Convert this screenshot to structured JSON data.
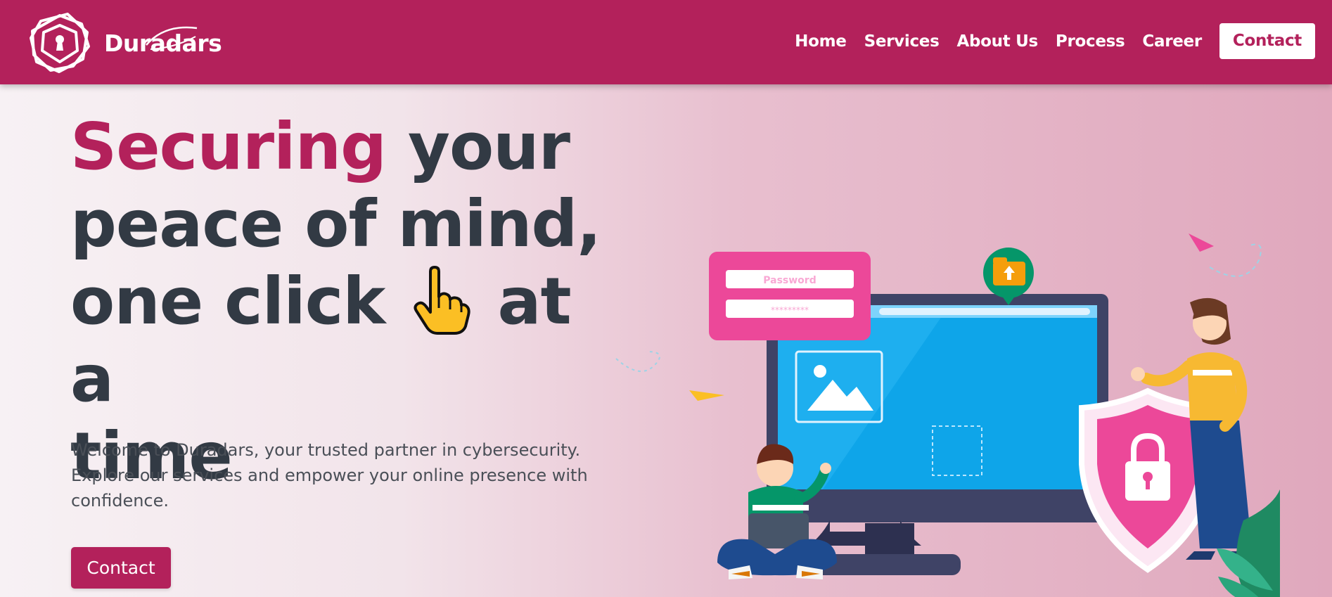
{
  "brand": {
    "name": "Duradars",
    "logo_icon": "shield-keyhole-icon"
  },
  "nav": {
    "items": [
      {
        "label": "Home"
      },
      {
        "label": "Services"
      },
      {
        "label": "About Us"
      },
      {
        "label": "Process"
      },
      {
        "label": "Career"
      }
    ],
    "contact_label": "Contact"
  },
  "hero": {
    "title_accent": "Securing",
    "title_line1_rest": " your",
    "title_line2": "peace of mind,",
    "title_line3_start": "one click",
    "title_line3_end": "at a",
    "title_line4": "time",
    "hand_icon": "pointing-hand-icon",
    "description": "Welcome to Duradars, your trusted partner in cybersecurity. Explore our services and empower your online presence with confidence.",
    "button_label": "Contact"
  },
  "illustration": {
    "password_label": "Password",
    "password_mask": "*********"
  },
  "colors": {
    "brand": "#b3215b",
    "heading": "#323a44",
    "text": "#4a4f57",
    "pink": "#ec4899",
    "screen": "#0ea5e9"
  }
}
